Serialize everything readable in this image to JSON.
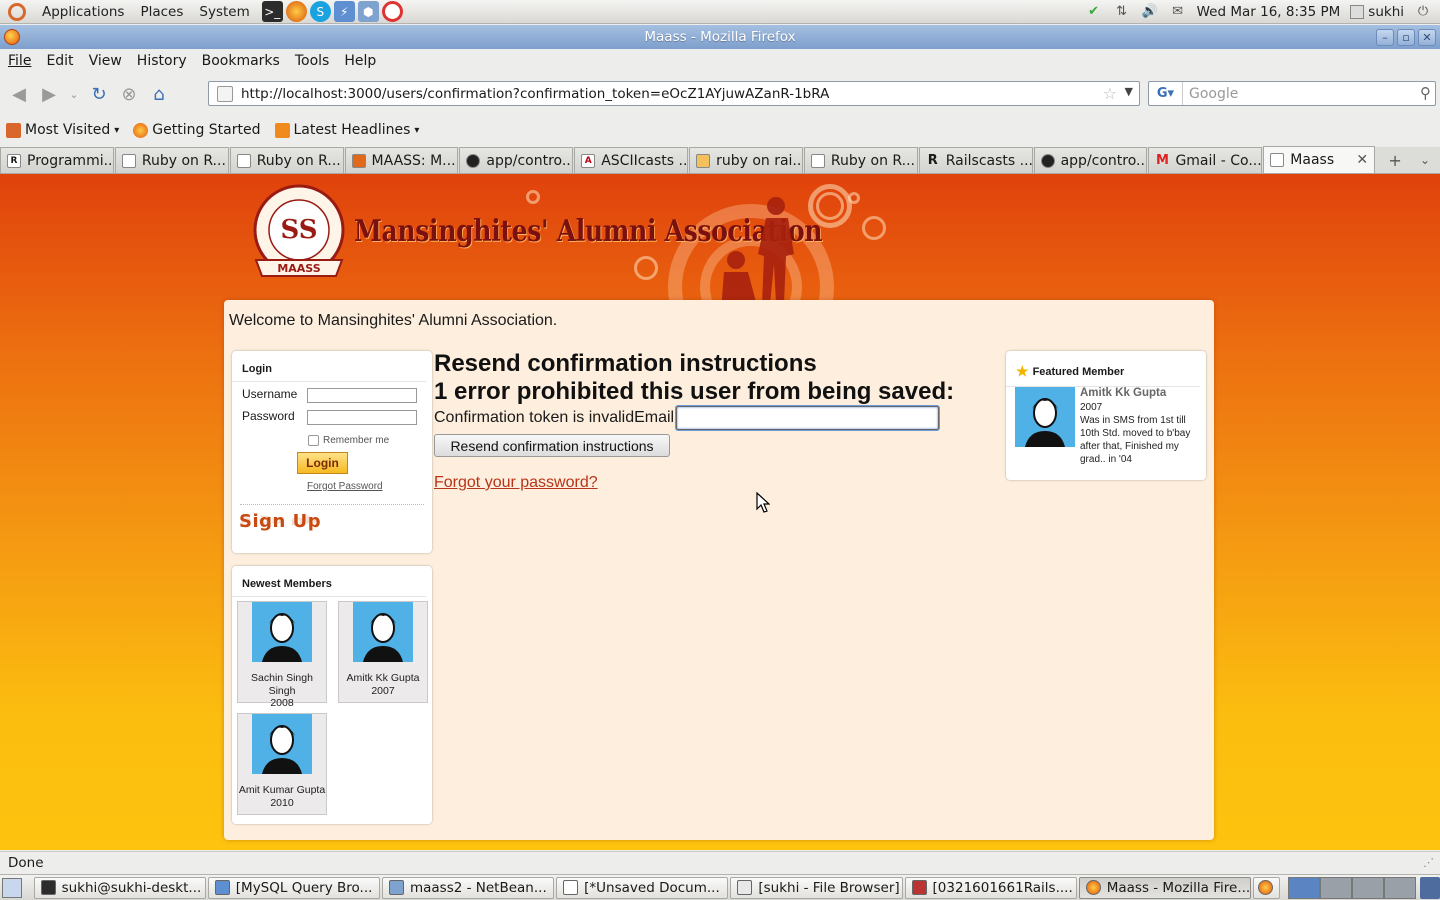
{
  "gnome_panel": {
    "menus": [
      "Applications",
      "Places",
      "System"
    ],
    "datetime": "Wed Mar 16,  8:35 PM",
    "user": "sukhi"
  },
  "window": {
    "title": "Maass - Mozilla Firefox"
  },
  "menubar": [
    "File",
    "Edit",
    "View",
    "History",
    "Bookmarks",
    "Tools",
    "Help"
  ],
  "navbar": {
    "url": "http://localhost:3000/users/confirmation?confirmation_token=eOcZ1AYjuwAZanR-1bRA",
    "search_placeholder": "Google"
  },
  "bookmarks": [
    {
      "label": "Most Visited",
      "icon": "most-visited-icon",
      "color": "#d9662c",
      "dropdown": true
    },
    {
      "label": "Getting Started",
      "icon": "firefox-icon",
      "color": "#e4560c",
      "dropdown": false
    },
    {
      "label": "Latest Headlines",
      "icon": "rss-icon",
      "color": "#f08a1c",
      "dropdown": true
    }
  ],
  "tabs": [
    {
      "label": "Programmi...",
      "icon": "R"
    },
    {
      "label": "Ruby on R...",
      "icon": ""
    },
    {
      "label": "Ruby on R...",
      "icon": ""
    },
    {
      "label": "MAASS: M...",
      "icon": ""
    },
    {
      "label": "app/contro...",
      "icon": ""
    },
    {
      "label": "ASCIIcasts ...",
      "icon": "A"
    },
    {
      "label": "ruby on rai...",
      "icon": ""
    },
    {
      "label": "Ruby on R...",
      "icon": ""
    },
    {
      "label": "Railscasts ...",
      "icon": "R"
    },
    {
      "label": "app/contro...",
      "icon": ""
    },
    {
      "label": "Gmail - Co...",
      "icon": "M"
    },
    {
      "label": "Maass",
      "icon": "",
      "active": true
    }
  ],
  "site": {
    "title": "Mansinghites' Alumni Association",
    "logo_text": "MAASS",
    "logo_ring_text": "MANSINGHITES' ALUMNI ASSOCIATION",
    "welcome": "Welcome to Mansinghites' Alumni Association."
  },
  "login": {
    "title": "Login",
    "username_label": "Username",
    "password_label": "Password",
    "remember_label": "Remember me",
    "button": "Login",
    "forgot": "Forgot Password",
    "signup": "Sign Up"
  },
  "newest_members": {
    "title": "Newest Members",
    "members": [
      {
        "name": "Sachin Singh Singh",
        "year": "2008"
      },
      {
        "name": "Amitk Kk Gupta",
        "year": "2007"
      },
      {
        "name": "Amit Kumar Gupta",
        "year": "2010"
      }
    ]
  },
  "form": {
    "heading": "Resend confirmation instructions",
    "error_heading": "1 error prohibited this user from being saved:",
    "error_message": "Confirmation token is invalid",
    "email_label": "Email",
    "email_value": "",
    "submit": "Resend confirmation instructions",
    "forgot_link": "Forgot your password?"
  },
  "featured": {
    "title": "Featured Member",
    "name": "Amitk Kk Gupta",
    "year": "2007",
    "bio": "Was in SMS from 1st till 10th Std. moved to b'bay after that, Finished my grad.. in '04"
  },
  "statusbar": {
    "text": "Done"
  },
  "taskbar": [
    {
      "label": "sukhi@sukhi-deskt...",
      "active": false
    },
    {
      "label": "[MySQL Query Bro...",
      "active": false
    },
    {
      "label": "maass2 - NetBean...",
      "active": false
    },
    {
      "label": "[*Unsaved Docum...",
      "active": false
    },
    {
      "label": "[sukhi - File Browser]",
      "active": false
    },
    {
      "label": "[0321601661Rails....",
      "active": false
    },
    {
      "label": "Maass - Mozilla Fire...",
      "active": true
    }
  ]
}
